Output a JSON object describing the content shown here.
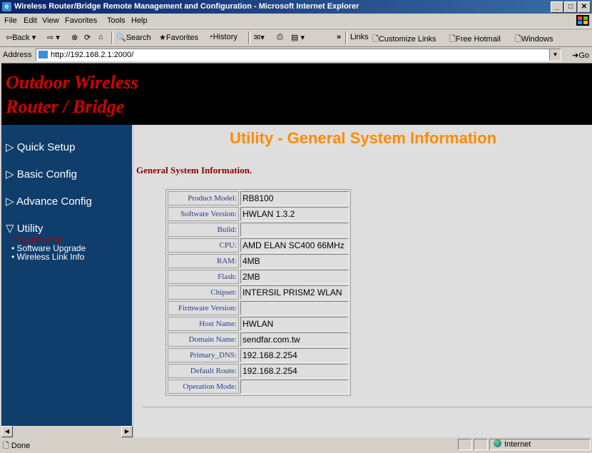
{
  "window": {
    "title": "Wireless Router/Bridge Remote Management and Configuration - Microsoft Internet Explorer",
    "min_label": "_",
    "max_label": "□",
    "close_label": "✕"
  },
  "menu": [
    "File",
    "Edit",
    "View",
    "Favorites",
    "Tools",
    "Help"
  ],
  "toolbar": {
    "back": "⇦Back ▾",
    "forward": "⇨ ▾",
    "stop": "⊗",
    "refresh": "⟳",
    "home": "⌂",
    "search": "Search",
    "favorites": "Favorites",
    "history": "History",
    "mail": "✉▾",
    "print": "⎙",
    "edit": "▤ ▾",
    "chevron": "»",
    "links_label": "Links",
    "links": [
      "Customize Links",
      "Free Hotmail",
      "Windows"
    ]
  },
  "address": {
    "label": "Address",
    "url": "http://192.168.2.1:2000/",
    "go": "Go"
  },
  "banner": {
    "line1": "Outdoor Wireless",
    "line2": "Router / Bridge"
  },
  "sidebar": {
    "items": [
      {
        "marker": "▷",
        "label": "Quick Setup"
      },
      {
        "marker": "▷",
        "label": "Basic Config"
      },
      {
        "marker": "▷",
        "label": "Advance Config"
      },
      {
        "marker": "▽",
        "label": "Utility"
      }
    ],
    "subitems": [
      {
        "label": "System Info",
        "active": true
      },
      {
        "label": "Software Upgrade",
        "active": false
      },
      {
        "label": "Wireless Link Info",
        "active": false
      }
    ]
  },
  "main": {
    "title": "Utility - General System Information",
    "subtitle": "General System Information.",
    "rows": [
      {
        "label": "Product Model:",
        "value": "RB8100"
      },
      {
        "label": "Software Version:",
        "value": "HWLAN 1.3.2"
      },
      {
        "label": "Build:",
        "value": ""
      },
      {
        "label": "CPU:",
        "value": "AMD ELAN SC400 66MHz"
      },
      {
        "label": "RAM:",
        "value": "4MB"
      },
      {
        "label": "Flash:",
        "value": "2MB"
      },
      {
        "label": "Chipset:",
        "value": "INTERSIL PRISM2 WLAN"
      },
      {
        "label": "Firmware Version:",
        "value": ""
      },
      {
        "label": "Host Name:",
        "value": "HWLAN"
      },
      {
        "label": "Domain Name:",
        "value": "sendfar.com.tw"
      },
      {
        "label": "Primary_DNS:",
        "value": "192.168.2.254"
      },
      {
        "label": "Default Route:",
        "value": "192.168.2.254"
      },
      {
        "label": "Operation Mode:",
        "value": ""
      }
    ]
  },
  "status": {
    "text": "Done",
    "zone": "Internet"
  },
  "colors": {
    "title_orange": "#ff8a00",
    "banner_red": "#d40000",
    "sidebar_blue": "#0f3d6c",
    "label_blue": "#253d8a",
    "subtitle_red": "#8b0000",
    "active_nav_red": "#b00000"
  }
}
